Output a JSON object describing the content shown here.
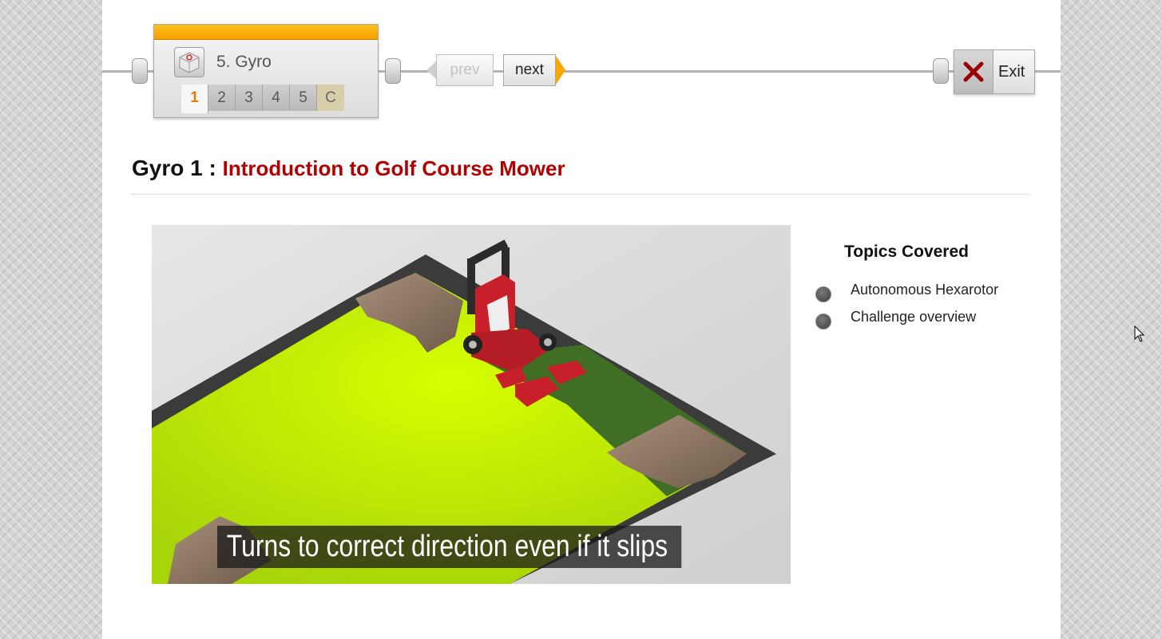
{
  "module": {
    "title": "5. Gyro",
    "steps": [
      "1",
      "2",
      "3",
      "4",
      "5",
      "C"
    ],
    "active_step": "1"
  },
  "nav": {
    "prev_label": "prev",
    "next_label": "next",
    "exit_label": "Exit"
  },
  "heading": {
    "prefix": "Gyro 1 : ",
    "title": "Introduction to Golf Course Mower"
  },
  "media": {
    "caption": "Turns to correct direction even if it slips"
  },
  "topics": {
    "title": "Topics Covered",
    "items": [
      "Autonomous Hexarotor",
      "Challenge overview"
    ]
  },
  "colors": {
    "accent_orange": "#f5a800",
    "title_red": "#b00000",
    "grass": "#c8f000",
    "mower_red": "#c8202a"
  },
  "icons": [
    "ev3-brick-icon",
    "close-x-icon",
    "pointer-cursor-icon"
  ]
}
